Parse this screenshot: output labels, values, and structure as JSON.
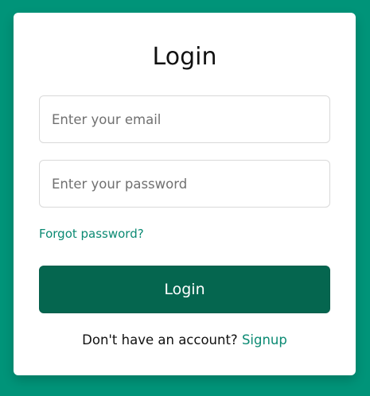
{
  "form": {
    "title": "Login",
    "email_placeholder": "Enter your email",
    "password_placeholder": "Enter your password",
    "forgot_label": "Forgot password?",
    "submit_label": "Login",
    "signup_prompt": "Don't have an account?",
    "signup_label": "Signup"
  },
  "colors": {
    "background": "#009479",
    "card": "#ffffff",
    "button": "#05664f",
    "link": "#0b8a73"
  }
}
